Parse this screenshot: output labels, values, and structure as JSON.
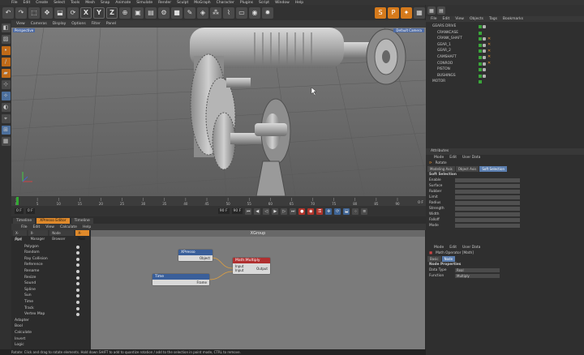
{
  "menubar": [
    "File",
    "Edit",
    "Create",
    "Select",
    "Tools",
    "Mesh",
    "Snap",
    "Animate",
    "Simulate",
    "Render",
    "Sculpt",
    "MoGraph",
    "Character",
    "Plugins",
    "Script",
    "Window",
    "Help"
  ],
  "viewport": {
    "menu": [
      "View",
      "Cameras",
      "Display",
      "Options",
      "Filter",
      "Panel"
    ],
    "camera_label": "Perspective",
    "right_badge": "Default Camera"
  },
  "timeline": {
    "ticks": [
      "0",
      "5",
      "10",
      "15",
      "20",
      "25",
      "30",
      "35",
      "40",
      "45",
      "50",
      "55",
      "60",
      "65",
      "70",
      "75",
      "80",
      "85",
      "90"
    ],
    "end_label": "0 F",
    "start_field": "0 F",
    "min_field": "0 F",
    "max_field": "90 F",
    "end_field": "90 F"
  },
  "xpresso": {
    "window_tabs": [
      "Timeline",
      "XPresso Editor",
      "Timeline"
    ],
    "menu": [
      "File",
      "Edit",
      "View",
      "Calculate",
      "Help"
    ],
    "left_tabs": [
      "X-Pool",
      "X-Manager",
      "Node Browser",
      "X-Pool"
    ],
    "tree": [
      {
        "label": "Port",
        "node": false
      },
      {
        "label": "Polygon",
        "node": true
      },
      {
        "label": "Random",
        "node": true
      },
      {
        "label": "Ray Collision",
        "node": true
      },
      {
        "label": "Reference",
        "node": true
      },
      {
        "label": "Rename",
        "node": true
      },
      {
        "label": "Resize",
        "node": true
      },
      {
        "label": "Sound",
        "node": true
      },
      {
        "label": "Spline",
        "node": true
      },
      {
        "label": "Sun",
        "node": true
      },
      {
        "label": "Time",
        "node": true
      },
      {
        "label": "Track",
        "node": true
      },
      {
        "label": "Vertex Map",
        "node": true
      },
      {
        "label": "Adapter",
        "node": false
      },
      {
        "label": "Bool",
        "node": false
      },
      {
        "label": "Calculate",
        "node": false
      },
      {
        "label": "Invert",
        "node": false
      },
      {
        "label": "Logic",
        "node": false
      }
    ],
    "group_title": "XGroup",
    "nodes": {
      "object_node": {
        "title": "XPresso",
        "port": "Object"
      },
      "time_node": {
        "title": "Time",
        "port": "Frame"
      },
      "math_node": {
        "title": "Math:Multiply",
        "in_ports": [
          "Input",
          "Input"
        ],
        "out_port": "Output"
      }
    }
  },
  "status": "Rotate: Click and drag to rotate elements. Hold down SHIFT to add to quantize rotation / add to the selection in point mode, CTRL to remove.",
  "object_manager": {
    "menu": [
      "File",
      "Edit",
      "View",
      "Objects",
      "Tags",
      "Bookmarks"
    ],
    "objects": [
      {
        "name": "GEARS DRIVE",
        "tags": 1
      },
      {
        "name": "CRANKCASE",
        "tags": 0
      },
      {
        "name": "CRANK_SHAFT",
        "tags": 2
      },
      {
        "name": "GEAR_1",
        "tags": 2
      },
      {
        "name": "GEAR_2",
        "tags": 2
      },
      {
        "name": "CAMSHAFT",
        "tags": 2
      },
      {
        "name": "CONROD",
        "tags": 2
      },
      {
        "name": "PISTON",
        "tags": 1
      },
      {
        "name": "BUSHINGS",
        "tags": 1
      },
      {
        "name": "MOTOR",
        "tags": 0
      }
    ]
  },
  "attributes_top": {
    "header": "Attributes",
    "menu": [
      "Mode",
      "Edit",
      "User Data"
    ],
    "tool": "Rotate",
    "tabs": [
      "Modeling Axis",
      "Object Axis",
      "Soft Selection"
    ],
    "section": "Soft Selection",
    "props": [
      "Enable",
      "Surface",
      "Rubber",
      "Limit",
      "Radius",
      "Strength",
      "Width",
      "Falloff",
      "Mode"
    ]
  },
  "attributes_bottom": {
    "menu": [
      "Mode",
      "Edit",
      "User Data"
    ],
    "title": "Math Operator [Math]",
    "tabs": [
      "Basic",
      "Node"
    ],
    "section": "Node Properties",
    "props": [
      {
        "label": "Data Type",
        "value": "Real"
      },
      {
        "label": "Function",
        "value": "Multiply"
      }
    ]
  },
  "colors": {
    "accent_orange": "#e08a2b",
    "selection_blue": "#4d6aa3",
    "node_red": "#b03030",
    "node_blue": "#3a5f9a",
    "active_green": "#3aa63a"
  }
}
